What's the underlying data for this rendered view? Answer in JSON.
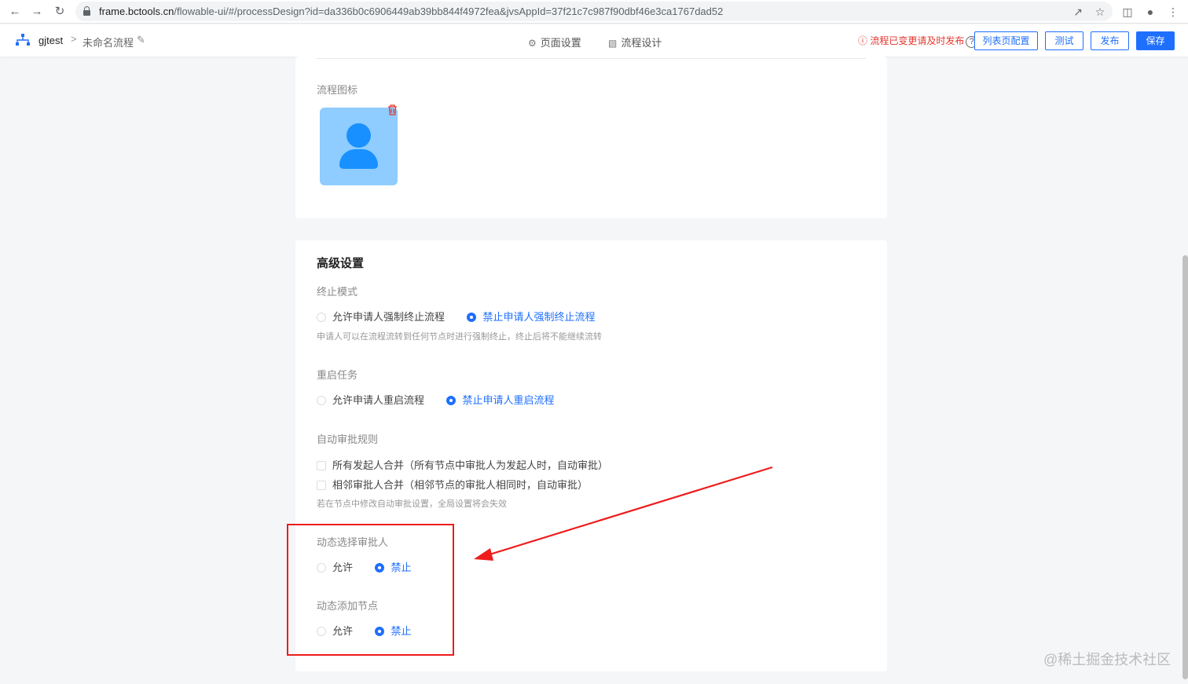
{
  "browser": {
    "url_host": "frame.bctools.cn",
    "url_rest": "/flowable-ui/#/processDesign?id=da336b0c6906449ab39bb844f4972fea&jvsAppId=37f21c7c987f90dbf46e3ca1767dad52"
  },
  "header": {
    "app_name": "gjtest",
    "separator": ">",
    "process_name": "未命名流程",
    "tabs": [
      {
        "label": "页面设置",
        "icon": "gear-icon"
      },
      {
        "label": "流程设计",
        "icon": "flow-icon"
      }
    ],
    "warning": "流程已变更请及时发布",
    "help_symbol": "?",
    "buttons": {
      "list_config": "列表页配置",
      "test": "测试",
      "publish": "发布",
      "save": "保存"
    }
  },
  "card1": {
    "icon_label": "流程图标"
  },
  "advanced": {
    "title": "高级设置",
    "terminate": {
      "label": "终止模式",
      "options": [
        "允许申请人强制终止流程",
        "禁止申请人强制终止流程"
      ],
      "selected": 1,
      "hint": "申请人可以在流程流转到任何节点时进行强制终止，终止后将不能继续流转"
    },
    "restart": {
      "label": "重启任务",
      "options": [
        "允许申请人重启流程",
        "禁止申请人重启流程"
      ],
      "selected": 1
    },
    "auto_approve": {
      "label": "自动审批规则",
      "checks": [
        "所有发起人合并（所有节点中审批人为发起人时，自动审批）",
        "相邻审批人合并（相邻节点的审批人相同时，自动审批）"
      ],
      "hint": "若在节点中修改自动审批设置，全局设置将会失效"
    },
    "dynamic_approver": {
      "label": "动态选择审批人",
      "options": [
        "允许",
        "禁止"
      ],
      "selected": 1
    },
    "dynamic_node": {
      "label": "动态添加节点",
      "options": [
        "允许",
        "禁止"
      ],
      "selected": 1
    }
  },
  "watermark": "@稀土掘金技术社区",
  "colors": {
    "primary": "#1f6fff",
    "warning": "#e5352b",
    "annotation": "#ee1c1c"
  }
}
